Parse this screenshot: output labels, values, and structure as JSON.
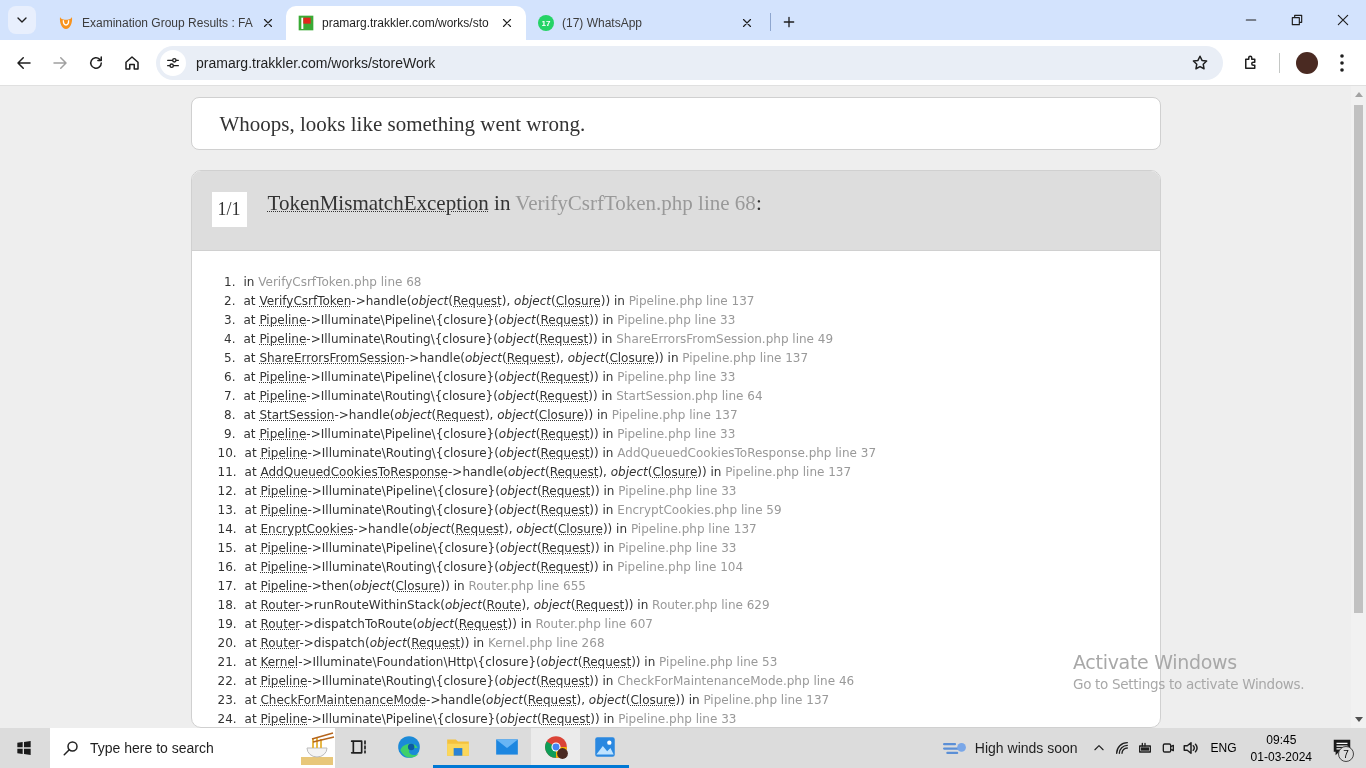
{
  "browser": {
    "tabs": [
      {
        "kind": "shield",
        "title": "Examination Group Results : FA",
        "selected": false
      },
      {
        "kind": "flag",
        "title": "pramarg.trakkler.com/works/sto",
        "selected": true
      },
      {
        "kind": "chat",
        "badge": "17",
        "title": "(17) WhatsApp",
        "selected": false
      }
    ],
    "address": "pramarg.trakkler.com/works/storeWork",
    "forward_disabled": true
  },
  "message": "Whoops, looks like something went wrong.",
  "exception": {
    "count": "1/1",
    "name": "TokenMismatchException",
    "connector": " in ",
    "location": "VerifyCsrfToken.php line 68",
    "suffix": ":",
    "frames": [
      {
        "number": "1.",
        "parts": [
          {
            "kind": "plain",
            "text": "in "
          },
          {
            "kind": "file",
            "text": "VerifyCsrfToken.php line 68"
          }
        ]
      },
      {
        "number": "2.",
        "parts": [
          {
            "kind": "plain",
            "text": "at "
          },
          {
            "kind": "class",
            "text": "VerifyCsrfToken"
          },
          {
            "kind": "plain",
            "text": "->handle("
          },
          {
            "kind": "italic",
            "text": "object"
          },
          {
            "kind": "plain",
            "text": "("
          },
          {
            "kind": "class",
            "text": "Request"
          },
          {
            "kind": "plain",
            "text": "), "
          },
          {
            "kind": "italic",
            "text": "object"
          },
          {
            "kind": "plain",
            "text": "("
          },
          {
            "kind": "class",
            "text": "Closure"
          },
          {
            "kind": "plain",
            "text": ")) in "
          },
          {
            "kind": "file",
            "text": "Pipeline.php line 137"
          }
        ]
      },
      {
        "number": "3.",
        "parts": [
          {
            "kind": "plain",
            "text": "at "
          },
          {
            "kind": "class",
            "text": "Pipeline"
          },
          {
            "kind": "plain",
            "text": "->Illuminate\\Pipeline\\{closure}("
          },
          {
            "kind": "italic",
            "text": "object"
          },
          {
            "kind": "plain",
            "text": "("
          },
          {
            "kind": "class",
            "text": "Request"
          },
          {
            "kind": "plain",
            "text": ")) in "
          },
          {
            "kind": "file",
            "text": "Pipeline.php line 33"
          }
        ]
      },
      {
        "number": "4.",
        "parts": [
          {
            "kind": "plain",
            "text": "at "
          },
          {
            "kind": "class",
            "text": "Pipeline"
          },
          {
            "kind": "plain",
            "text": "->Illuminate\\Routing\\{closure}("
          },
          {
            "kind": "italic",
            "text": "object"
          },
          {
            "kind": "plain",
            "text": "("
          },
          {
            "kind": "class",
            "text": "Request"
          },
          {
            "kind": "plain",
            "text": ")) in "
          },
          {
            "kind": "file",
            "text": "ShareErrorsFromSession.php line 49"
          }
        ]
      },
      {
        "number": "5.",
        "parts": [
          {
            "kind": "plain",
            "text": "at "
          },
          {
            "kind": "class",
            "text": "ShareErrorsFromSession"
          },
          {
            "kind": "plain",
            "text": "->handle("
          },
          {
            "kind": "italic",
            "text": "object"
          },
          {
            "kind": "plain",
            "text": "("
          },
          {
            "kind": "class",
            "text": "Request"
          },
          {
            "kind": "plain",
            "text": "), "
          },
          {
            "kind": "italic",
            "text": "object"
          },
          {
            "kind": "plain",
            "text": "("
          },
          {
            "kind": "class",
            "text": "Closure"
          },
          {
            "kind": "plain",
            "text": ")) in "
          },
          {
            "kind": "file",
            "text": "Pipeline.php line 137"
          }
        ]
      },
      {
        "number": "6.",
        "parts": [
          {
            "kind": "plain",
            "text": "at "
          },
          {
            "kind": "class",
            "text": "Pipeline"
          },
          {
            "kind": "plain",
            "text": "->Illuminate\\Pipeline\\{closure}("
          },
          {
            "kind": "italic",
            "text": "object"
          },
          {
            "kind": "plain",
            "text": "("
          },
          {
            "kind": "class",
            "text": "Request"
          },
          {
            "kind": "plain",
            "text": ")) in "
          },
          {
            "kind": "file",
            "text": "Pipeline.php line 33"
          }
        ]
      },
      {
        "number": "7.",
        "parts": [
          {
            "kind": "plain",
            "text": "at "
          },
          {
            "kind": "class",
            "text": "Pipeline"
          },
          {
            "kind": "plain",
            "text": "->Illuminate\\Routing\\{closure}("
          },
          {
            "kind": "italic",
            "text": "object"
          },
          {
            "kind": "plain",
            "text": "("
          },
          {
            "kind": "class",
            "text": "Request"
          },
          {
            "kind": "plain",
            "text": ")) in "
          },
          {
            "kind": "file",
            "text": "StartSession.php line 64"
          }
        ]
      },
      {
        "number": "8.",
        "parts": [
          {
            "kind": "plain",
            "text": "at "
          },
          {
            "kind": "class",
            "text": "StartSession"
          },
          {
            "kind": "plain",
            "text": "->handle("
          },
          {
            "kind": "italic",
            "text": "object"
          },
          {
            "kind": "plain",
            "text": "("
          },
          {
            "kind": "class",
            "text": "Request"
          },
          {
            "kind": "plain",
            "text": "), "
          },
          {
            "kind": "italic",
            "text": "object"
          },
          {
            "kind": "plain",
            "text": "("
          },
          {
            "kind": "class",
            "text": "Closure"
          },
          {
            "kind": "plain",
            "text": ")) in "
          },
          {
            "kind": "file",
            "text": "Pipeline.php line 137"
          }
        ]
      },
      {
        "number": "9.",
        "parts": [
          {
            "kind": "plain",
            "text": "at "
          },
          {
            "kind": "class",
            "text": "Pipeline"
          },
          {
            "kind": "plain",
            "text": "->Illuminate\\Pipeline\\{closure}("
          },
          {
            "kind": "italic",
            "text": "object"
          },
          {
            "kind": "plain",
            "text": "("
          },
          {
            "kind": "class",
            "text": "Request"
          },
          {
            "kind": "plain",
            "text": ")) in "
          },
          {
            "kind": "file",
            "text": "Pipeline.php line 33"
          }
        ]
      },
      {
        "number": "10.",
        "parts": [
          {
            "kind": "plain",
            "text": "at "
          },
          {
            "kind": "class",
            "text": "Pipeline"
          },
          {
            "kind": "plain",
            "text": "->Illuminate\\Routing\\{closure}("
          },
          {
            "kind": "italic",
            "text": "object"
          },
          {
            "kind": "plain",
            "text": "("
          },
          {
            "kind": "class",
            "text": "Request"
          },
          {
            "kind": "plain",
            "text": ")) in "
          },
          {
            "kind": "file",
            "text": "AddQueuedCookiesToResponse.php line 37"
          }
        ]
      },
      {
        "number": "11.",
        "parts": [
          {
            "kind": "plain",
            "text": "at "
          },
          {
            "kind": "class",
            "text": "AddQueuedCookiesToResponse"
          },
          {
            "kind": "plain",
            "text": "->handle("
          },
          {
            "kind": "italic",
            "text": "object"
          },
          {
            "kind": "plain",
            "text": "("
          },
          {
            "kind": "class",
            "text": "Request"
          },
          {
            "kind": "plain",
            "text": "), "
          },
          {
            "kind": "italic",
            "text": "object"
          },
          {
            "kind": "plain",
            "text": "("
          },
          {
            "kind": "class",
            "text": "Closure"
          },
          {
            "kind": "plain",
            "text": ")) in "
          },
          {
            "kind": "file",
            "text": "Pipeline.php line 137"
          }
        ]
      },
      {
        "number": "12.",
        "parts": [
          {
            "kind": "plain",
            "text": "at "
          },
          {
            "kind": "class",
            "text": "Pipeline"
          },
          {
            "kind": "plain",
            "text": "->Illuminate\\Pipeline\\{closure}("
          },
          {
            "kind": "italic",
            "text": "object"
          },
          {
            "kind": "plain",
            "text": "("
          },
          {
            "kind": "class",
            "text": "Request"
          },
          {
            "kind": "plain",
            "text": ")) in "
          },
          {
            "kind": "file",
            "text": "Pipeline.php line 33"
          }
        ]
      },
      {
        "number": "13.",
        "parts": [
          {
            "kind": "plain",
            "text": "at "
          },
          {
            "kind": "class",
            "text": "Pipeline"
          },
          {
            "kind": "plain",
            "text": "->Illuminate\\Routing\\{closure}("
          },
          {
            "kind": "italic",
            "text": "object"
          },
          {
            "kind": "plain",
            "text": "("
          },
          {
            "kind": "class",
            "text": "Request"
          },
          {
            "kind": "plain",
            "text": ")) in "
          },
          {
            "kind": "file",
            "text": "EncryptCookies.php line 59"
          }
        ]
      },
      {
        "number": "14.",
        "parts": [
          {
            "kind": "plain",
            "text": "at "
          },
          {
            "kind": "class",
            "text": "EncryptCookies"
          },
          {
            "kind": "plain",
            "text": "->handle("
          },
          {
            "kind": "italic",
            "text": "object"
          },
          {
            "kind": "plain",
            "text": "("
          },
          {
            "kind": "class",
            "text": "Request"
          },
          {
            "kind": "plain",
            "text": "), "
          },
          {
            "kind": "italic",
            "text": "object"
          },
          {
            "kind": "plain",
            "text": "("
          },
          {
            "kind": "class",
            "text": "Closure"
          },
          {
            "kind": "plain",
            "text": ")) in "
          },
          {
            "kind": "file",
            "text": "Pipeline.php line 137"
          }
        ]
      },
      {
        "number": "15.",
        "parts": [
          {
            "kind": "plain",
            "text": "at "
          },
          {
            "kind": "class",
            "text": "Pipeline"
          },
          {
            "kind": "plain",
            "text": "->Illuminate\\Pipeline\\{closure}("
          },
          {
            "kind": "italic",
            "text": "object"
          },
          {
            "kind": "plain",
            "text": "("
          },
          {
            "kind": "class",
            "text": "Request"
          },
          {
            "kind": "plain",
            "text": ")) in "
          },
          {
            "kind": "file",
            "text": "Pipeline.php line 33"
          }
        ]
      },
      {
        "number": "16.",
        "parts": [
          {
            "kind": "plain",
            "text": "at "
          },
          {
            "kind": "class",
            "text": "Pipeline"
          },
          {
            "kind": "plain",
            "text": "->Illuminate\\Routing\\{closure}("
          },
          {
            "kind": "italic",
            "text": "object"
          },
          {
            "kind": "plain",
            "text": "("
          },
          {
            "kind": "class",
            "text": "Request"
          },
          {
            "kind": "plain",
            "text": ")) in "
          },
          {
            "kind": "file",
            "text": "Pipeline.php line 104"
          }
        ]
      },
      {
        "number": "17.",
        "parts": [
          {
            "kind": "plain",
            "text": "at "
          },
          {
            "kind": "class",
            "text": "Pipeline"
          },
          {
            "kind": "plain",
            "text": "->then("
          },
          {
            "kind": "italic",
            "text": "object"
          },
          {
            "kind": "plain",
            "text": "("
          },
          {
            "kind": "class",
            "text": "Closure"
          },
          {
            "kind": "plain",
            "text": ")) in "
          },
          {
            "kind": "file",
            "text": "Router.php line 655"
          }
        ]
      },
      {
        "number": "18.",
        "parts": [
          {
            "kind": "plain",
            "text": "at "
          },
          {
            "kind": "class",
            "text": "Router"
          },
          {
            "kind": "plain",
            "text": "->runRouteWithinStack("
          },
          {
            "kind": "italic",
            "text": "object"
          },
          {
            "kind": "plain",
            "text": "("
          },
          {
            "kind": "class",
            "text": "Route"
          },
          {
            "kind": "plain",
            "text": "), "
          },
          {
            "kind": "italic",
            "text": "object"
          },
          {
            "kind": "plain",
            "text": "("
          },
          {
            "kind": "class",
            "text": "Request"
          },
          {
            "kind": "plain",
            "text": ")) in "
          },
          {
            "kind": "file",
            "text": "Router.php line 629"
          }
        ]
      },
      {
        "number": "19.",
        "parts": [
          {
            "kind": "plain",
            "text": "at "
          },
          {
            "kind": "class",
            "text": "Router"
          },
          {
            "kind": "plain",
            "text": "->dispatchToRoute("
          },
          {
            "kind": "italic",
            "text": "object"
          },
          {
            "kind": "plain",
            "text": "("
          },
          {
            "kind": "class",
            "text": "Request"
          },
          {
            "kind": "plain",
            "text": ")) in "
          },
          {
            "kind": "file",
            "text": "Router.php line 607"
          }
        ]
      },
      {
        "number": "20.",
        "parts": [
          {
            "kind": "plain",
            "text": "at "
          },
          {
            "kind": "class",
            "text": "Router"
          },
          {
            "kind": "plain",
            "text": "->dispatch("
          },
          {
            "kind": "italic",
            "text": "object"
          },
          {
            "kind": "plain",
            "text": "("
          },
          {
            "kind": "class",
            "text": "Request"
          },
          {
            "kind": "plain",
            "text": ")) in "
          },
          {
            "kind": "file",
            "text": "Kernel.php line 268"
          }
        ]
      },
      {
        "number": "21.",
        "parts": [
          {
            "kind": "plain",
            "text": "at "
          },
          {
            "kind": "class",
            "text": "Kernel"
          },
          {
            "kind": "plain",
            "text": "->Illuminate\\Foundation\\Http\\{closure}("
          },
          {
            "kind": "italic",
            "text": "object"
          },
          {
            "kind": "plain",
            "text": "("
          },
          {
            "kind": "class",
            "text": "Request"
          },
          {
            "kind": "plain",
            "text": ")) in "
          },
          {
            "kind": "file",
            "text": "Pipeline.php line 53"
          }
        ]
      },
      {
        "number": "22.",
        "parts": [
          {
            "kind": "plain",
            "text": "at "
          },
          {
            "kind": "class",
            "text": "Pipeline"
          },
          {
            "kind": "plain",
            "text": "->Illuminate\\Routing\\{closure}("
          },
          {
            "kind": "italic",
            "text": "object"
          },
          {
            "kind": "plain",
            "text": "("
          },
          {
            "kind": "class",
            "text": "Request"
          },
          {
            "kind": "plain",
            "text": ")) in "
          },
          {
            "kind": "file",
            "text": "CheckForMaintenanceMode.php line 46"
          }
        ]
      },
      {
        "number": "23.",
        "parts": [
          {
            "kind": "plain",
            "text": "at "
          },
          {
            "kind": "class",
            "text": "CheckForMaintenanceMode"
          },
          {
            "kind": "plain",
            "text": "->handle("
          },
          {
            "kind": "italic",
            "text": "object"
          },
          {
            "kind": "plain",
            "text": "("
          },
          {
            "kind": "class",
            "text": "Request"
          },
          {
            "kind": "plain",
            "text": "), "
          },
          {
            "kind": "italic",
            "text": "object"
          },
          {
            "kind": "plain",
            "text": "("
          },
          {
            "kind": "class",
            "text": "Closure"
          },
          {
            "kind": "plain",
            "text": ")) in "
          },
          {
            "kind": "file",
            "text": "Pipeline.php line 137"
          }
        ]
      },
      {
        "number": "24.",
        "parts": [
          {
            "kind": "plain",
            "text": "at "
          },
          {
            "kind": "class",
            "text": "Pipeline"
          },
          {
            "kind": "plain",
            "text": "->Illuminate\\Pipeline\\{closure}("
          },
          {
            "kind": "italic",
            "text": "object"
          },
          {
            "kind": "plain",
            "text": "("
          },
          {
            "kind": "class",
            "text": "Request"
          },
          {
            "kind": "plain",
            "text": ")) in "
          },
          {
            "kind": "file",
            "text": "Pipeline.php line 33"
          }
        ]
      }
    ]
  },
  "activation": {
    "title": "Activate Windows",
    "subtitle": "Go to Settings to activate Windows."
  },
  "taskbar": {
    "search": {
      "placeholder": "Type here to search"
    },
    "apps": [
      {
        "kind": "edge",
        "running": false,
        "selected": false
      },
      {
        "kind": "folder",
        "running": true,
        "selected": false
      },
      {
        "kind": "mail",
        "running": true,
        "selected": false
      },
      {
        "kind": "chrome",
        "running": true,
        "selected": true
      },
      {
        "kind": "photos",
        "running": true,
        "selected": false
      }
    ],
    "weather": "High winds soon",
    "language": "ENG",
    "time": "09:45",
    "date": "01-03-2024",
    "notifications": "7"
  }
}
